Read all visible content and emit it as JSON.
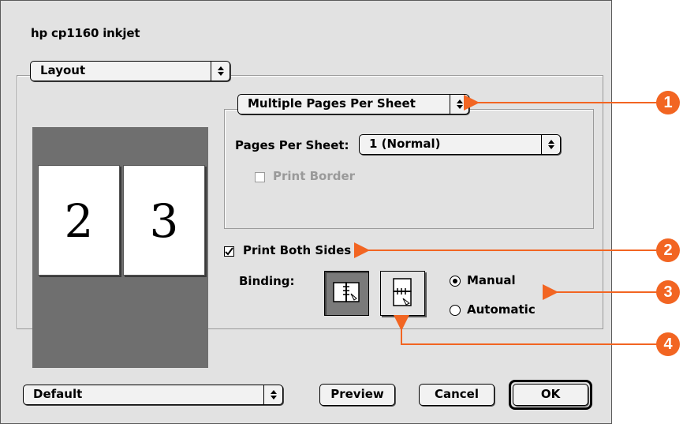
{
  "window": {
    "title": "hp cp1160 inkjet"
  },
  "panel_popup": {
    "value": "Layout"
  },
  "layout_popup": {
    "value": "Multiple Pages Per Sheet"
  },
  "pages_per_sheet": {
    "label": "Pages Per Sheet:",
    "value": "1 (Normal)"
  },
  "print_border": {
    "label": "Print Border",
    "checked": false,
    "enabled": false
  },
  "preview": {
    "pages": [
      "2",
      "3"
    ]
  },
  "print_both_sides": {
    "label": "Print Both Sides",
    "checked": true
  },
  "binding": {
    "label": "Binding:",
    "options": [
      {
        "name": "Manual",
        "selected": true
      },
      {
        "name": "Automatic",
        "selected": false
      }
    ]
  },
  "footer": {
    "settings_popup": "Default",
    "preview_label": "Preview",
    "cancel_label": "Cancel",
    "ok_label": "OK"
  },
  "callouts": [
    "1",
    "2",
    "3",
    "4"
  ],
  "colors": {
    "accent": "#f26522",
    "dialog_bg": "#e2e2e2",
    "preview_bg": "#6f6f6f"
  }
}
